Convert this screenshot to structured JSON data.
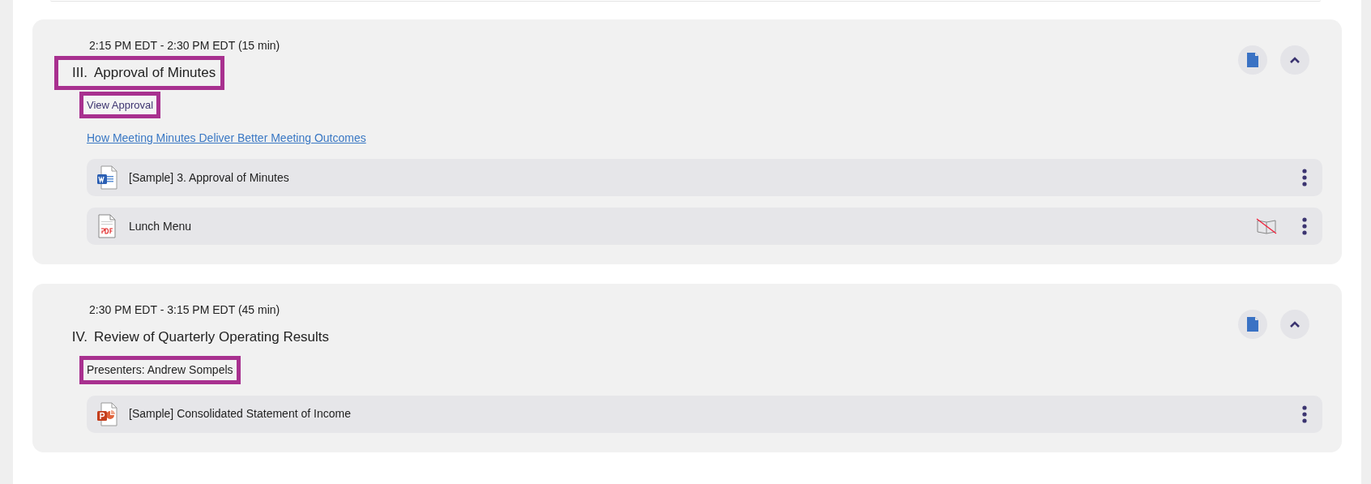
{
  "agenda_items": [
    {
      "number": "III.",
      "time": "2:15 PM EDT - 2:30 PM EDT (15 min)",
      "title": "Approval of Minutes",
      "title_highlighted": true,
      "expanded": true,
      "tag": {
        "kind": "action",
        "text": "View Approval",
        "highlighted": true
      },
      "links": [
        "How Meeting Minutes Deliver Better Meeting Outcomes"
      ],
      "files": [
        {
          "kind": "word",
          "name": "[Sample] 3. Approval of Minutes",
          "preview_disabled": false
        },
        {
          "kind": "pdf",
          "name": "Lunch Menu",
          "preview_disabled": true
        }
      ]
    },
    {
      "number": "IV.",
      "time": "2:30 PM EDT - 3:15 PM EDT (45 min)",
      "title": "Review of Quarterly Operating Results",
      "title_highlighted": false,
      "expanded": true,
      "tag": {
        "kind": "presenters",
        "text": "Presenters: Andrew Sompels",
        "highlighted": true
      },
      "files": [
        {
          "kind": "powerpoint",
          "name": "[Sample] Consolidated Statement of Income",
          "preview_disabled": false
        }
      ]
    }
  ]
}
